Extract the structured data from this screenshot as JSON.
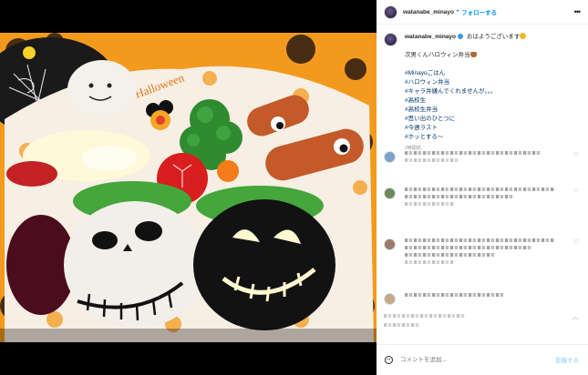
{
  "header": {
    "username": "watanabe_minayo",
    "separator": "•",
    "follow_label": "フォローする",
    "more_label": "•••"
  },
  "caption": {
    "username": "watanabe_minayo",
    "greeting": "おはようございます",
    "line1": "次男くんハロウィン弁当",
    "hashtags": [
      "#Minayoごはん",
      "#ハロウィン弁当",
      "#キャラ弁嫌んでくれませんが。。。",
      "#高校生",
      "#高校生弁当",
      "#思い出のひとつに",
      "#今週ラスト",
      "#ホッとする〜"
    ],
    "timestamp": "2時間前"
  },
  "composer": {
    "placeholder": "コメントを追加...",
    "post_label": "投稿する"
  },
  "photo": {
    "subject": "halloween-bento",
    "wrap_text": "Halloween"
  },
  "colors": {
    "accent": "#0095f6",
    "hashtag": "#00376b",
    "orange": "#f39a1e",
    "rice_ball_dark": "#111111"
  }
}
